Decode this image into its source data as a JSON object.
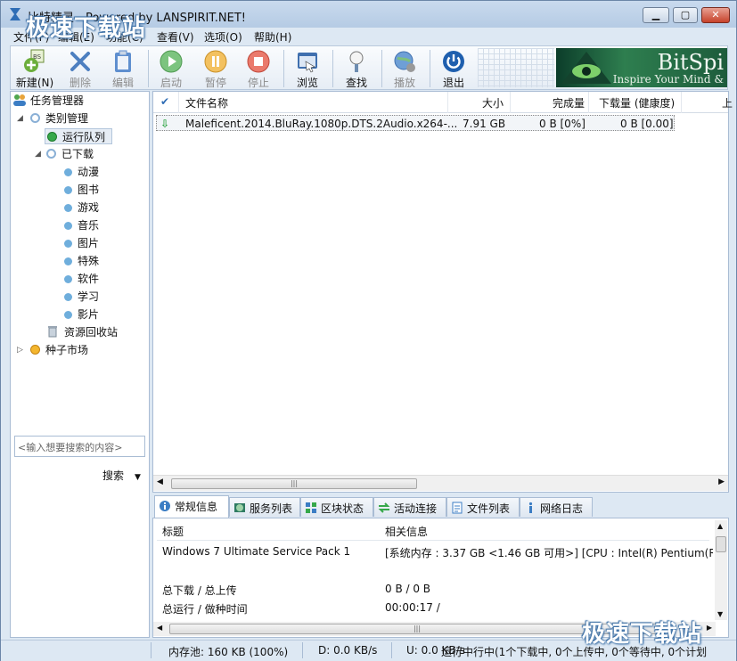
{
  "window": {
    "title": "比特精灵 - Powered by LANSPIRIT.NET!"
  },
  "menu": [
    "文件(F)",
    "编辑(E)",
    "功能(C)",
    "查看(V)",
    "选项(O)",
    "帮助(H)"
  ],
  "toolbar": {
    "new": "新建(N)",
    "delete": "删除",
    "edit": "编辑",
    "start": "启动",
    "pause": "暂停",
    "stop": "停止",
    "browse": "浏览",
    "find": "查找",
    "play": "播放",
    "exit": "退出"
  },
  "banner": {
    "title": "BitSpi",
    "slogan": "Inspire Your Mind &"
  },
  "tree": {
    "root": "任务管理器",
    "category": "类别管理",
    "running": "运行队列",
    "downloaded": "已下载",
    "sub": [
      "动漫",
      "图书",
      "游戏",
      "音乐",
      "图片",
      "特殊",
      "软件",
      "学习",
      "影片"
    ],
    "recycle": "资源回收站",
    "market": "种子市场"
  },
  "search": {
    "placeholder": "<输入想要搜索的内容>",
    "button": "搜索"
  },
  "columns": {
    "name": "文件名称",
    "size": "大小",
    "done": "完成量",
    "dl": "下载量 (健康度)",
    "up": "上"
  },
  "rows": [
    {
      "name": "Maleficent.2014.BluRay.1080p.DTS.2Audio.x264-...",
      "size": "7.91 GB",
      "done": "0 B [0%]",
      "dl": "0 B [0.00]"
    }
  ],
  "tabs": [
    "常规信息",
    "服务列表",
    "区块状态",
    "活动连接",
    "文件列表",
    "网络日志"
  ],
  "info": {
    "h_title": "标题",
    "h_info": "相关信息",
    "os": "Windows 7 Ultimate Service Pack 1",
    "sys": "[系统内存 : 3.37 GB <1.46 GB 可用>] [CPU : Intel(R) Pentium(R) C",
    "dl_label": "总下载 / 总上传",
    "dl_val": "0 B / 0 B",
    "time_label": "总运行 / 做种时间",
    "time_val": "00:00:17 /"
  },
  "status": {
    "mem": "内存池: 160 KB (100%)",
    "down": "D: 0.0 KB/s",
    "up": "U: 0.0 KB/s",
    "tasks": "运行中行中(1个下载中, 0个上传中, 0个等待中, 0个计划"
  },
  "watermark": "极速下载站",
  "colors": {
    "accent": "#3b7dc4",
    "green": "#36a84a"
  }
}
